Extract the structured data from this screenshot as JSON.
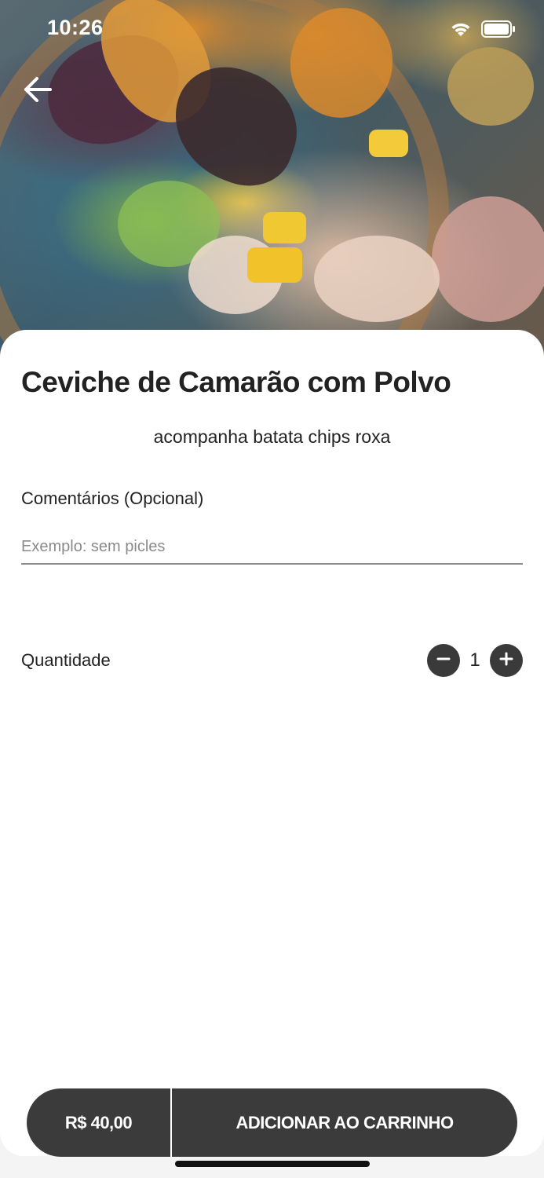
{
  "status_bar": {
    "time": "10:26",
    "icons": [
      "wifi-icon",
      "battery-icon"
    ]
  },
  "header": {
    "back_icon": "arrow-left-icon"
  },
  "product": {
    "title": "Ceviche de Camarão com Polvo",
    "description": "acompanha batata chips roxa"
  },
  "comments": {
    "label": "Comentários (Opcional)",
    "placeholder": "Exemplo: sem picles",
    "value": ""
  },
  "quantity": {
    "label": "Quantidade",
    "value": "1",
    "decrement_icon": "minus-icon",
    "increment_icon": "plus-icon"
  },
  "cart_bar": {
    "price": "R$ 40,00",
    "add_label": "ADICIONAR AO CARRINHO"
  },
  "colors": {
    "accent": "#3b3b3b",
    "background": "#ffffff",
    "text": "#222222",
    "placeholder": "#8a8a8a"
  }
}
